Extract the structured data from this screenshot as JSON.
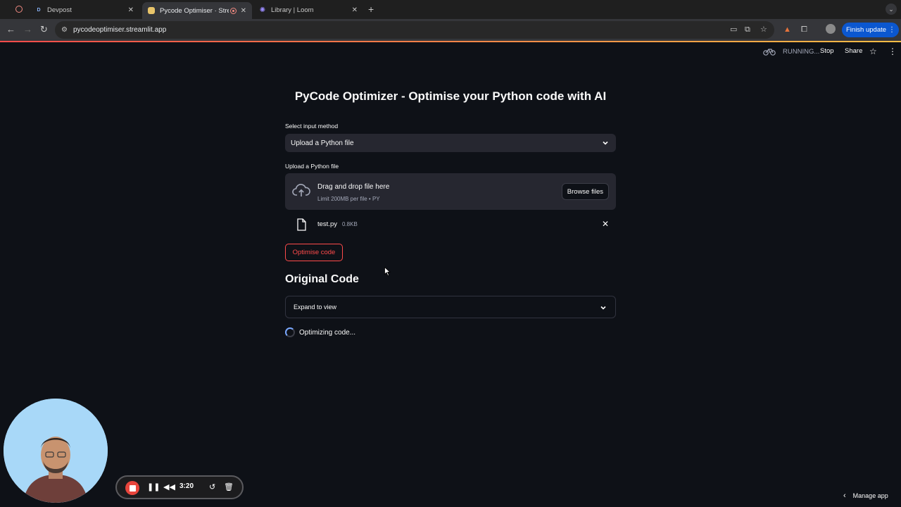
{
  "browser": {
    "tabs": [
      {
        "title": "Devpost",
        "favicon": "D"
      },
      {
        "title": "Pycode Optimiser · Strea",
        "favicon": "streamlit-icon"
      },
      {
        "title": "Library | Loom",
        "favicon": "loom-icon"
      }
    ],
    "new_tab": "+",
    "url": "pycodeoptimiser.streamlit.app",
    "finish_update": "Finish update"
  },
  "streamlit_header": {
    "status": "RUNNING...",
    "stop": "Stop",
    "share": "Share"
  },
  "main": {
    "title": "PyCode Optimizer - Optimise your Python code with AI",
    "input_method": {
      "label": "Select input method",
      "value": "Upload a Python file"
    },
    "uploader": {
      "label": "Upload a Python file",
      "drag_text": "Drag and drop file here",
      "limit_text": "Limit 200MB per file • PY",
      "browse_label": "Browse files"
    },
    "file": {
      "name": "test.py",
      "size": "0.8KB"
    },
    "optimise_button": "Optimise code",
    "original_code_heading": "Original Code",
    "expander_label": "Expand to view",
    "spinner_text": "Optimizing code..."
  },
  "loom": {
    "time": "3:20"
  },
  "footer": {
    "manage_app": "Manage app"
  },
  "colors": {
    "background": "#0e1117",
    "widget": "#262730",
    "primary": "#ff4b4b",
    "chrome_update": "#0b57d0"
  }
}
